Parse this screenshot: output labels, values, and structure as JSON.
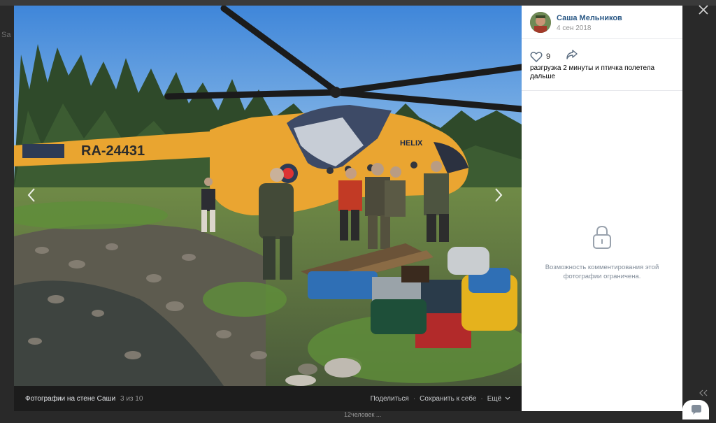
{
  "author": {
    "name": "Саша Мельников",
    "date": "4 сен 2018"
  },
  "post": {
    "likes": "9",
    "caption": "разгрузка 2 минуты и птичка полетела дальше"
  },
  "comments": {
    "restricted_text": "Возможность комментирования этой фотографии ограничена."
  },
  "photo": {
    "helicopter_registration": "RA-24431",
    "helicopter_brand": "HELIX"
  },
  "bottom_bar": {
    "album": "Фотографии на стене Саши",
    "counter": "3 из 10",
    "share": "Поделиться",
    "save": "Сохранить к себе",
    "more": "Ещё"
  },
  "background": {
    "left_label": "Sa",
    "below_text": "12человек ..."
  },
  "icons": {
    "close": "close-icon",
    "prev": "chevron-left-icon",
    "next": "chevron-right-icon",
    "like": "heart-icon",
    "share": "share-arrow-icon",
    "lock": "lock-icon",
    "chat": "chat-bubble-icon"
  },
  "colors": {
    "link": "#2a5885",
    "muted": "#939393",
    "backdrop": "#292929"
  }
}
